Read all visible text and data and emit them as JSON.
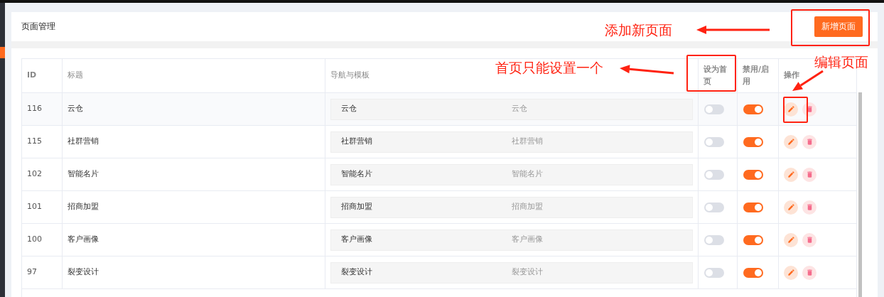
{
  "header": {
    "title": "页面管理",
    "add_button": "新增页面"
  },
  "table": {
    "columns": [
      "ID",
      "标题",
      "导航与模板",
      "设为首页",
      "禁用/启用",
      "操作"
    ],
    "rows": [
      {
        "id": "116",
        "title": "云仓",
        "nav": "云仓",
        "template": "云仓",
        "is_home": false,
        "enabled": true
      },
      {
        "id": "115",
        "title": "社群营销",
        "nav": "社群营销",
        "template": "社群营销",
        "is_home": false,
        "enabled": true
      },
      {
        "id": "102",
        "title": "智能名片",
        "nav": "智能名片",
        "template": "智能名片",
        "is_home": false,
        "enabled": true
      },
      {
        "id": "101",
        "title": "招商加盟",
        "nav": "招商加盟",
        "template": "招商加盟",
        "is_home": false,
        "enabled": true
      },
      {
        "id": "100",
        "title": "客户画像",
        "nav": "客户画像",
        "template": "客户画像",
        "is_home": false,
        "enabled": true
      },
      {
        "id": "97",
        "title": "裂变设计",
        "nav": "裂变设计",
        "template": "裂变设计",
        "is_home": false,
        "enabled": true
      }
    ]
  },
  "annotations": [
    {
      "kind": "callout",
      "text": "添加新页面"
    },
    {
      "kind": "callout",
      "text": "首页只能设置一个"
    },
    {
      "kind": "callout",
      "text": "编辑页面"
    }
  ]
}
